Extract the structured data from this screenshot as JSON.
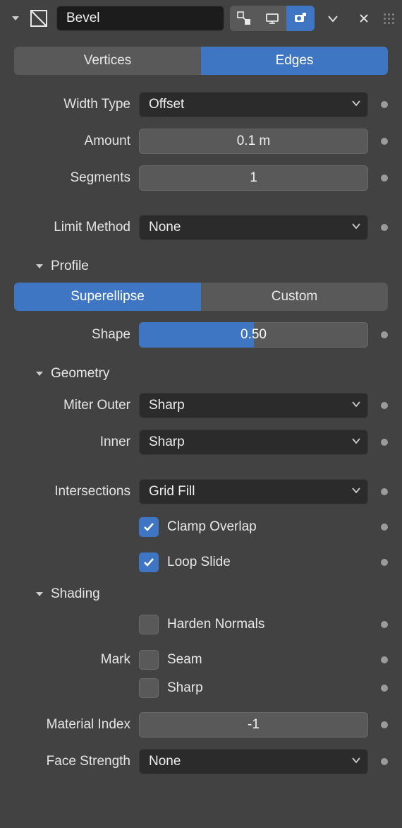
{
  "header": {
    "name": "Bevel"
  },
  "affect": {
    "vertices_label": "Vertices",
    "edges_label": "Edges",
    "active": "edges"
  },
  "main": {
    "width_type_label": "Width Type",
    "width_type_value": "Offset",
    "amount_label": "Amount",
    "amount_value": "0.1 m",
    "segments_label": "Segments",
    "segments_value": "1",
    "limit_method_label": "Limit Method",
    "limit_method_value": "None"
  },
  "profile": {
    "title": "Profile",
    "superellipse_label": "Superellipse",
    "custom_label": "Custom",
    "active": "superellipse",
    "shape_label": "Shape",
    "shape_value": "0.50",
    "shape_fraction": 0.5
  },
  "geometry": {
    "title": "Geometry",
    "miter_outer_label": "Miter Outer",
    "miter_outer_value": "Sharp",
    "inner_label": "Inner",
    "inner_value": "Sharp",
    "intersections_label": "Intersections",
    "intersections_value": "Grid Fill",
    "clamp_overlap_label": "Clamp Overlap",
    "clamp_overlap_checked": true,
    "loop_slide_label": "Loop Slide",
    "loop_slide_checked": true
  },
  "shading": {
    "title": "Shading",
    "harden_normals_label": "Harden Normals",
    "harden_normals_checked": false,
    "mark_label": "Mark",
    "seam_label": "Seam",
    "seam_checked": false,
    "sharp_label": "Sharp",
    "sharp_checked": false,
    "material_index_label": "Material Index",
    "material_index_value": "-1",
    "face_strength_label": "Face Strength",
    "face_strength_value": "None"
  }
}
